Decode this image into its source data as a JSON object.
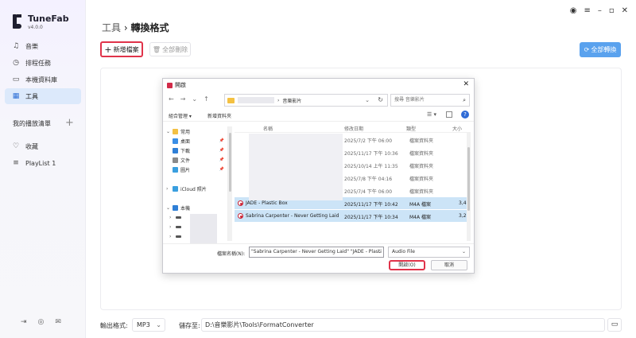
{
  "app": {
    "name": "TuneFab",
    "version": "v4.0.0"
  },
  "sidebar": {
    "nav": [
      {
        "label": "音樂",
        "icon": "music-note-icon"
      },
      {
        "label": "排程任務",
        "icon": "clock-icon"
      },
      {
        "label": "本機資料庫",
        "icon": "inbox-icon"
      },
      {
        "label": "工具",
        "icon": "grid-icon",
        "active": true
      }
    ],
    "playlist_title": "我的播放清單",
    "playlist_items": [
      {
        "label": "收藏",
        "icon": "heart-icon"
      },
      {
        "label": "PlayList 1",
        "icon": "playlist-icon"
      }
    ]
  },
  "header": {
    "crumb_root": "工具",
    "crumb_sep": "›",
    "crumb_current": "轉換格式"
  },
  "toolbar": {
    "add_label": "新增檔案",
    "delete_label": "全部刪除",
    "convert_label": "全部轉換"
  },
  "bottom": {
    "format_label": "輸出格式:",
    "format_value": "MP3",
    "save_label": "儲存至:",
    "save_path": "D:\\音樂影片\\Tools\\FormatConverter"
  },
  "dialog": {
    "title": "開啟",
    "address_folder": "音樂影片",
    "search_placeholder": "搜尋 音樂影片",
    "organize_label": "組合管理 ▾",
    "new_folder_label": "新增資料夾",
    "tree": [
      {
        "label": "常用",
        "icon": "star-icon",
        "chev": "⌄",
        "color": "#f3c043"
      },
      {
        "label": "桌面",
        "icon": "desktop-icon",
        "pin": true,
        "color": "#3a8ee6"
      },
      {
        "label": "下載",
        "icon": "download-icon",
        "pin": true,
        "color": "#2f7fd6"
      },
      {
        "label": "文件",
        "icon": "document-icon",
        "pin": true,
        "color": "#8a8a8a"
      },
      {
        "label": "圖片",
        "icon": "picture-icon",
        "pin": true,
        "color": "#3a9fdf"
      },
      {
        "label": "",
        "icon": "",
        "color": "transparent"
      },
      {
        "label": "iCloud 照片",
        "icon": "cloud-icon",
        "chev": "›",
        "color": "#3a9fdf"
      },
      {
        "label": "",
        "icon": "",
        "color": "transparent"
      },
      {
        "label": "本機",
        "icon": "computer-icon",
        "chev": "⌄",
        "color": "#2f7fd6"
      }
    ],
    "columns": {
      "name": "名稱",
      "modified": "修改日期",
      "type": "類型",
      "size": "大小"
    },
    "files": [
      {
        "name": "",
        "date": "2025/7/2 下午 06:00",
        "type": "檔案資料夾",
        "size": ""
      },
      {
        "name": "",
        "date": "2025/11/17 下午 10:36",
        "type": "檔案資料夾",
        "size": ""
      },
      {
        "name": "",
        "date": "2025/10/14 上午 11:35",
        "type": "檔案資料夾",
        "size": ""
      },
      {
        "name": "",
        "date": "2025/7/8 下午 04:16",
        "type": "檔案資料夾",
        "size": ""
      },
      {
        "name": "",
        "date": "2025/7/4 下午 06:00",
        "type": "檔案資料夾",
        "size": ""
      },
      {
        "name": "JADE - Plastic Box",
        "date": "2025/11/17 下午 10:42",
        "type": "M4A 檔案",
        "size": "3,4",
        "selected": true
      },
      {
        "name": "Sabrina Carpenter - Never Getting Laid",
        "date": "2025/11/17 下午 10:34",
        "type": "M4A 檔案",
        "size": "3,2",
        "selected": true
      }
    ],
    "filename_label": "檔案名稱(N):",
    "filename_value": "\"Sabrina Carpenter - Never Getting Laid\" \"JADE - Plasti",
    "filetype_value": "Audio File",
    "open_label": "開啟(O)",
    "cancel_label": "取消"
  }
}
